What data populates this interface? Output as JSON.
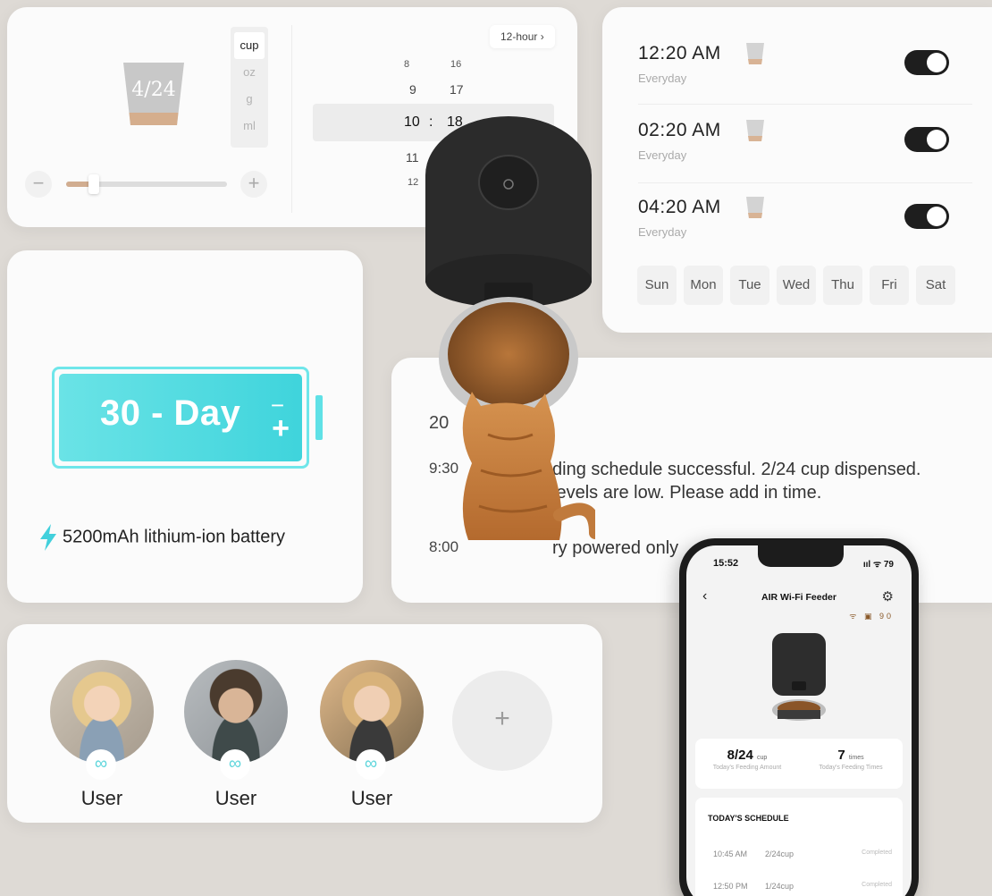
{
  "portion": {
    "cup_fraction": "4/24",
    "units": [
      "cup",
      "oz",
      "g",
      "ml"
    ],
    "selected_unit": "cup",
    "level": 0.17,
    "minus_label": "−",
    "plus_label": "+"
  },
  "time_picker": {
    "format_label": "12-hour ›",
    "hours": [
      "8",
      "9",
      "10",
      "11",
      "12"
    ],
    "minutes": [
      "16",
      "17",
      "18"
    ],
    "selected_hour": "10",
    "separator": ":",
    "selected_minute": "18"
  },
  "schedule": {
    "rows": [
      {
        "time": "12:20 AM",
        "repeat": "Everyday",
        "enabled": true
      },
      {
        "time": "02:20 AM",
        "repeat": "Everyday",
        "enabled": true
      },
      {
        "time": "04:20 AM",
        "repeat": "Everyday",
        "enabled": true
      }
    ],
    "days": [
      "Sun",
      "Mon",
      "Tue",
      "Wed",
      "Thu",
      "Fri",
      "Sat"
    ]
  },
  "battery": {
    "label": "30 - Day",
    "minus": "−",
    "plus": "+",
    "spec": "5200mAh lithium-ion battery",
    "accent": "#4fdbe0"
  },
  "notifications": {
    "date": "20",
    "items": [
      {
        "time": "9:30",
        "text": "ding schedule successful. 2/24 cup dispensed."
      },
      {
        "time": "",
        "text": "levels are low. Please add in time."
      },
      {
        "time": "8:00",
        "text": "ry powered only"
      }
    ]
  },
  "users": [
    {
      "name": "User",
      "badge": "∞"
    },
    {
      "name": "User",
      "badge": "∞"
    },
    {
      "name": "User",
      "badge": "∞"
    }
  ],
  "add_user_label": "+",
  "phone": {
    "status_time": "15:52",
    "status_icons": "ııl ᯤ 79",
    "back": "‹",
    "title": "AIR Wi-Fi Feeder",
    "gear": "⚙",
    "device_icons": "ᯤ ▣ 90",
    "stat_amount_value": "8/24",
    "stat_amount_unit": "cup",
    "stat_amount_label": "Today's Feeding Amount",
    "stat_times_value": "7",
    "stat_times_unit": "times",
    "stat_times_label": "Today's Feeding Times",
    "schedule_title": "TODAY'S SCHEDULE",
    "schedule_rows": [
      {
        "time": "10:45 AM",
        "amount": "2/24cup",
        "status": "Completed"
      },
      {
        "time": "12:50 PM",
        "amount": "1/24cup",
        "status": "Completed"
      }
    ]
  }
}
